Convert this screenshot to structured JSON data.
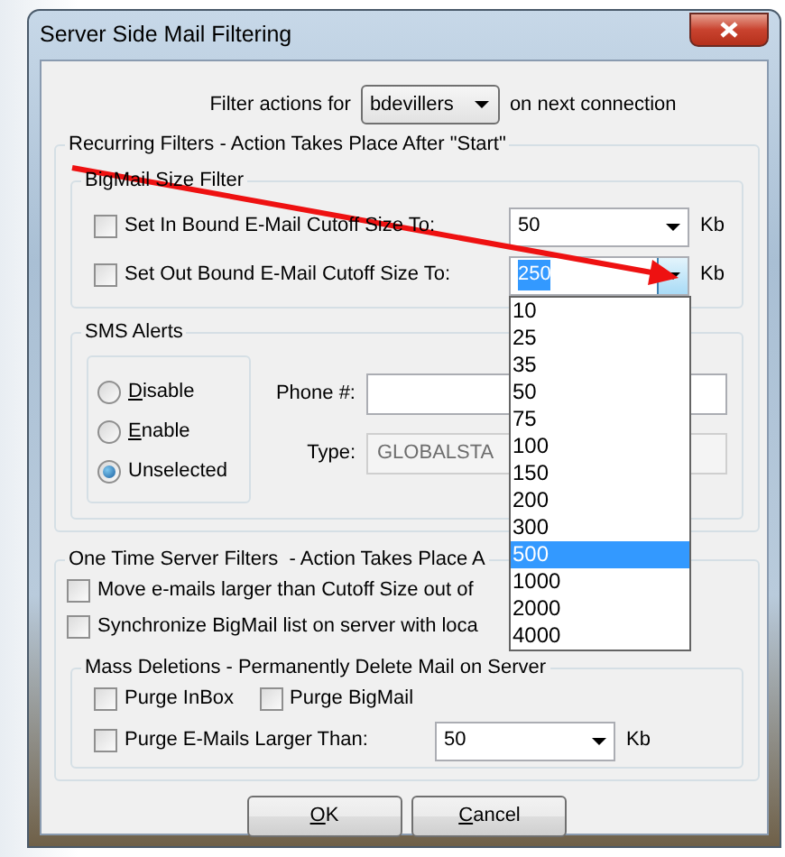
{
  "window": {
    "title": "Server Side Mail Filtering"
  },
  "filter_row": {
    "prefix": "Filter actions for",
    "user": "bdevillers",
    "suffix": "on next connection"
  },
  "recurring_filters": {
    "legend": "Recurring Filters - Action Takes Place After \"Start\"",
    "bigmail_size_filter": {
      "legend": "BigMail Size Filter",
      "rows": [
        {
          "label": "Set In Bound E-Mail Cutoff Size To:",
          "checked": false,
          "value": "50",
          "text_selected": false,
          "unit": "Kb",
          "open": false
        },
        {
          "label": "Set Out Bound E-Mail Cutoff Size To:",
          "checked": false,
          "value": "250",
          "text_selected": true,
          "unit": "Kb",
          "open": true,
          "options": [
            {
              "label": "10",
              "selected": false
            },
            {
              "label": "25",
              "selected": false
            },
            {
              "label": "35",
              "selected": false
            },
            {
              "label": "50",
              "selected": false
            },
            {
              "label": "75",
              "selected": false
            },
            {
              "label": "100",
              "selected": false
            },
            {
              "label": "150",
              "selected": false
            },
            {
              "label": "200",
              "selected": false
            },
            {
              "label": "300",
              "selected": false
            },
            {
              "label": "500",
              "selected": true
            },
            {
              "label": "1000",
              "selected": false
            },
            {
              "label": "2000",
              "selected": false
            },
            {
              "label": "4000",
              "selected": false
            }
          ]
        }
      ]
    },
    "sms_alerts": {
      "legend": "SMS Alerts",
      "options": [
        {
          "label": "Disable",
          "access_key": true,
          "selected": false
        },
        {
          "label": "Enable",
          "access_key": true,
          "selected": false
        },
        {
          "label": "Unselected",
          "access_key": false,
          "selected": true
        }
      ],
      "phone_label": "Phone #:",
      "type_label": "Type:",
      "type_value": "GLOBALSTA",
      "type_disabled": true
    }
  },
  "one_time_filters": {
    "legend": "One Time Server Filters  - Action Takes Place A",
    "options": [
      {
        "label": "Move e-mails larger than Cutoff Size out of",
        "checked": false
      },
      {
        "label": "Synchronize BigMail list on server with loca",
        "checked": false
      }
    ],
    "mass_deletions": {
      "legend": "Mass Deletions - Permanently Delete Mail on Server",
      "options": [
        {
          "label": "Purge InBox",
          "checked": false
        },
        {
          "label": "Purge BigMail",
          "checked": false
        }
      ],
      "larger_than": {
        "label": "Purge E-Mails Larger Than:",
        "checked": false,
        "value": "50",
        "unit": "Kb"
      }
    }
  },
  "buttons": [
    {
      "label": "OK",
      "access_key": true
    },
    {
      "label": "Cancel",
      "access_key": true
    }
  ]
}
